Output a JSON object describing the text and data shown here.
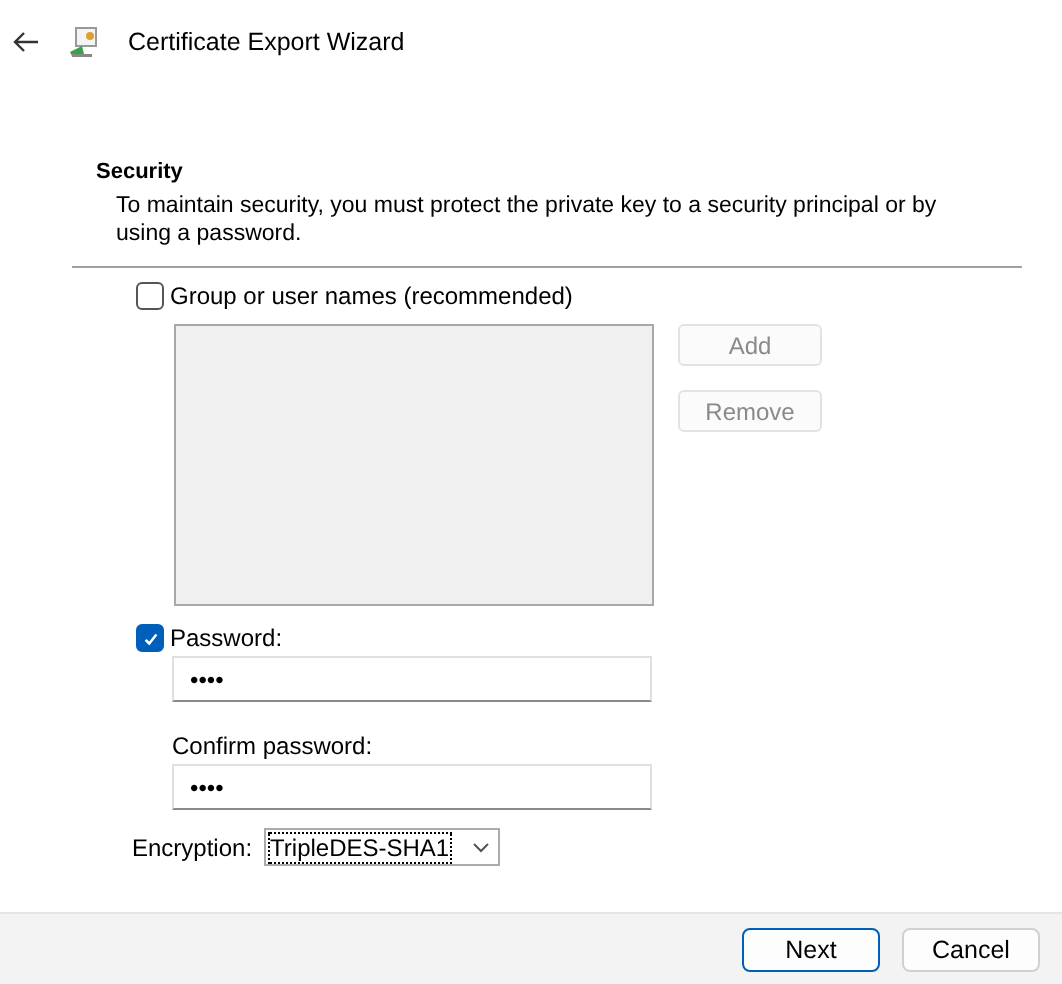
{
  "window": {
    "title": "Certificate Export Wizard"
  },
  "section": {
    "heading": "Security",
    "description": "To maintain security, you must protect the private key to a security principal or by using a password."
  },
  "group_option": {
    "label": "Group or user names (recommended)",
    "checked": false,
    "buttons": [
      {
        "label": "Add",
        "disabled": true
      },
      {
        "label": "Remove",
        "disabled": true
      }
    ]
  },
  "password_option": {
    "label": "Password:",
    "checked": true,
    "value": "••••",
    "confirm_label": "Confirm password:",
    "confirm_value": "••••"
  },
  "encryption": {
    "label": "Encryption:",
    "value": "TripleDES-SHA1"
  },
  "footer_buttons": [
    {
      "label": "Next",
      "default": true
    },
    {
      "label": "Cancel",
      "default": false
    }
  ]
}
